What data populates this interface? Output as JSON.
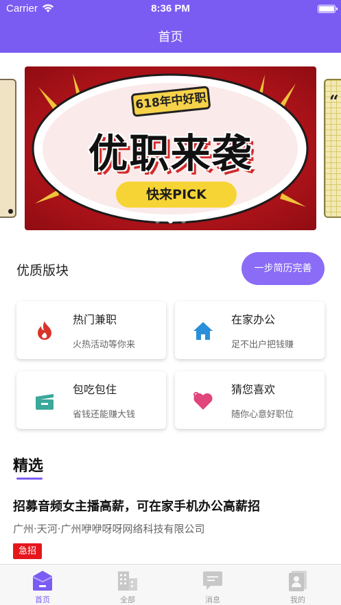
{
  "status_bar": {
    "carrier": "Carrier",
    "time": "8:36 PM"
  },
  "header": {
    "title": "首页"
  },
  "banner": {
    "badge_text": "618年中好职",
    "headline": "优职来袭",
    "cta": "快来PICK",
    "side_right_glyph": "“",
    "page_count": 3,
    "active_page": 2
  },
  "section": {
    "title": "优质版块",
    "resume_button": "一步简历完善"
  },
  "cards": [
    {
      "name": "热门兼职",
      "desc": "火热活动等你来",
      "icon": "flame-icon",
      "color": "#d8342a"
    },
    {
      "name": "在家办公",
      "desc": "足不出户把钱赚",
      "icon": "house-icon",
      "color": "#2a8fd8"
    },
    {
      "name": "包吃包住",
      "desc": "省钱还能赚大钱",
      "icon": "tray-icon",
      "color": "#3aa89a"
    },
    {
      "name": "猜您喜欢",
      "desc": "随你心意好职位",
      "icon": "heart-icon",
      "color": "#e0457b"
    }
  ],
  "featured": {
    "title": "精选",
    "job": {
      "title": "招募音频女主播高薪，可在家手机办公高薪招",
      "company": "广州·天河·广州咿咿呀呀网络科技有限公司",
      "tag": "急招"
    }
  },
  "tabbar": {
    "items": [
      {
        "label": "首页",
        "icon": "home-icon",
        "active": true
      },
      {
        "label": "全部",
        "icon": "building-icon",
        "active": false
      },
      {
        "label": "消息",
        "icon": "chat-icon",
        "active": false
      },
      {
        "label": "我的",
        "icon": "profile-icon",
        "active": false
      }
    ]
  },
  "colors": {
    "accent": "#7b5cf3",
    "banner_red": "#b3141b",
    "pill_yellow": "#f6d435",
    "urgent_red": "#e5161b"
  }
}
